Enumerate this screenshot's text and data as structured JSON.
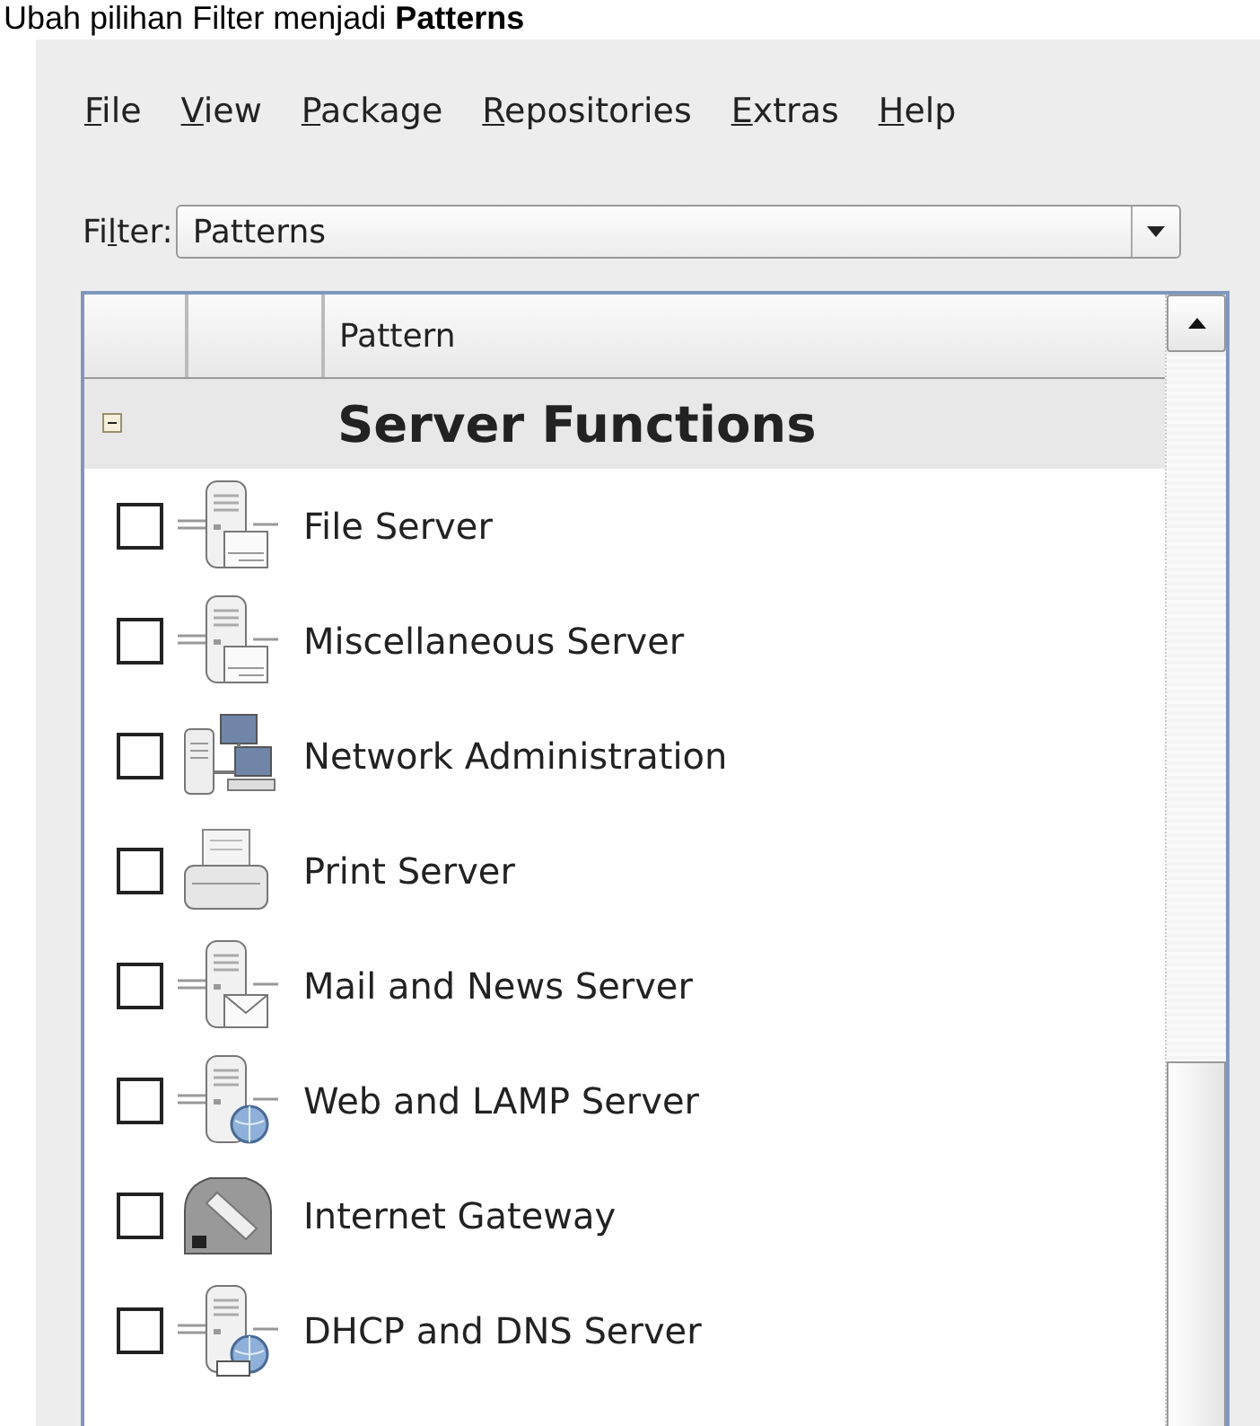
{
  "caption": "Ubah pilihan Filter menjadi **Patterns**",
  "menu": [
    {
      "key": "F",
      "rest": "ile"
    },
    {
      "key": "V",
      "rest": "iew"
    },
    {
      "key": "P",
      "rest": "ackage"
    },
    {
      "key": "R",
      "rest": "epositories"
    },
    {
      "key": "E",
      "rest": "xtras"
    },
    {
      "key": "H",
      "rest": "elp"
    }
  ],
  "filter": {
    "label_before": "Fi",
    "label_key": "l",
    "label_after": "ter:",
    "value": "Patterns"
  },
  "table": {
    "columns": [
      "Pattern"
    ],
    "group": {
      "title": "Server Functions",
      "expanded": true
    },
    "rows": [
      {
        "name": "File Server",
        "checked": false
      },
      {
        "name": "Miscellaneous Server",
        "checked": false
      },
      {
        "name": "Network Administration",
        "checked": false
      },
      {
        "name": "Print Server",
        "checked": false
      },
      {
        "name": "Mail and News Server",
        "checked": false
      },
      {
        "name": "Web and LAMP Server",
        "checked": false
      },
      {
        "name": "Internet Gateway",
        "checked": false
      },
      {
        "name": "DHCP and DNS Server",
        "checked": false
      }
    ]
  }
}
